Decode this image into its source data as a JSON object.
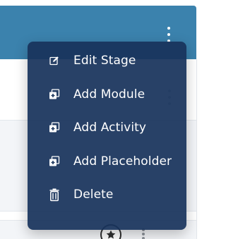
{
  "menu": {
    "items": [
      {
        "label": "Edit Stage",
        "icon": "edit-icon"
      },
      {
        "label": "Add Module",
        "icon": "add-module-icon"
      },
      {
        "label": "Add Activity",
        "icon": "add-activity-icon"
      },
      {
        "label": "Add Placeholder",
        "icon": "add-placeholder-icon"
      },
      {
        "label": "Delete",
        "icon": "trash-icon"
      }
    ]
  },
  "colors": {
    "header": "#3b82ad",
    "menu_bg": "#18335b",
    "text": "#ffffff"
  }
}
